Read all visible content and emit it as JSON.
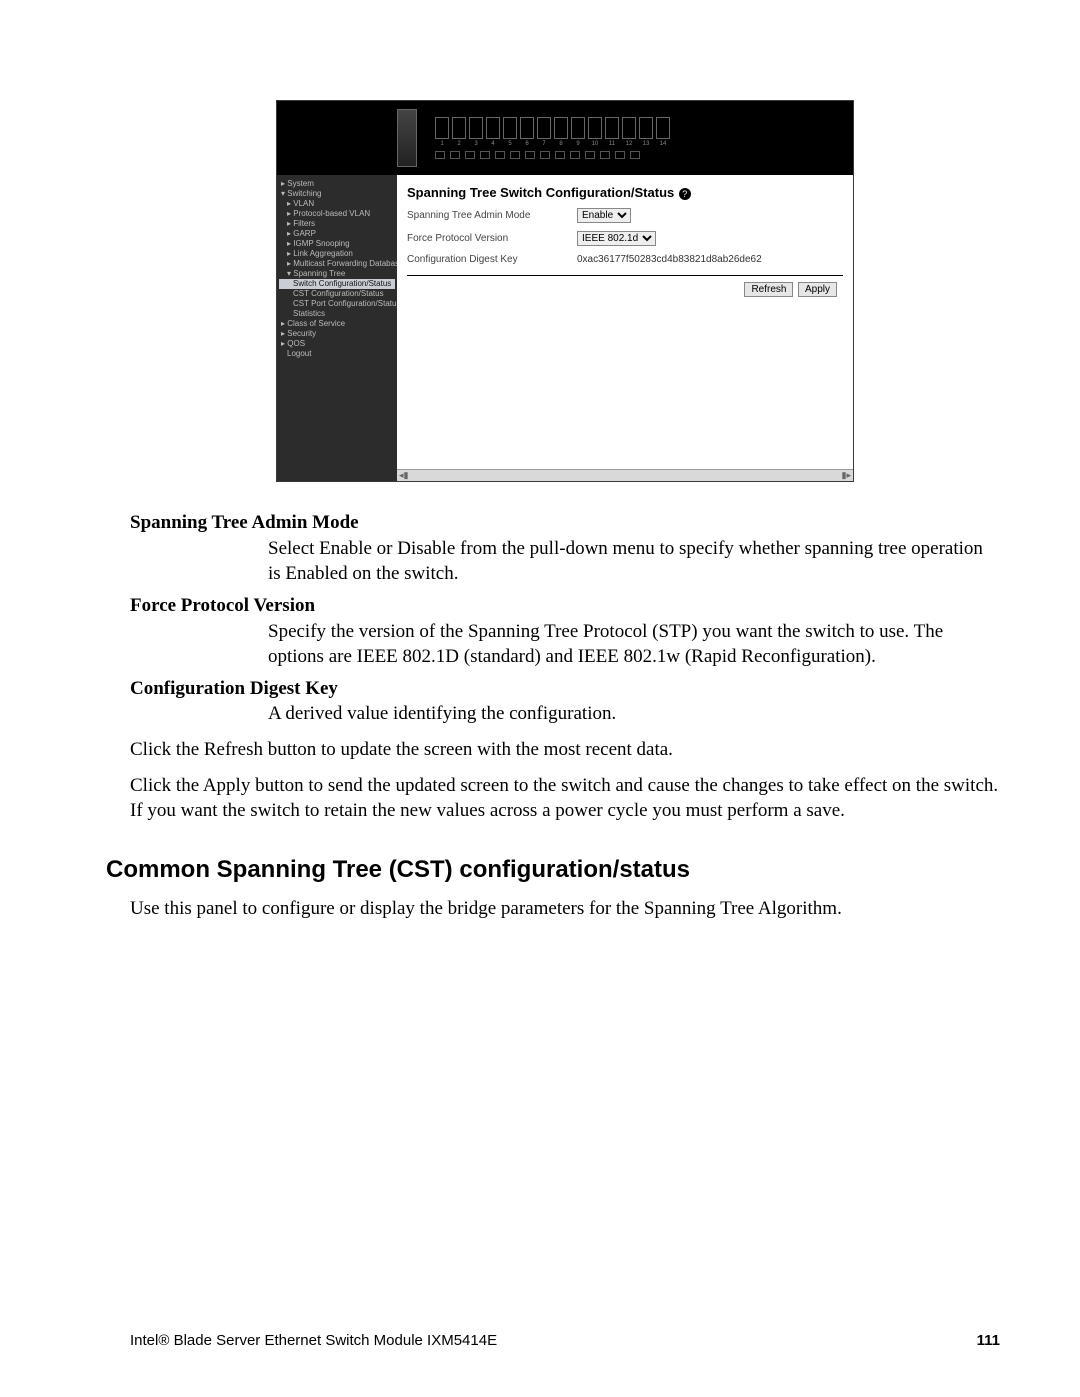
{
  "screenshot": {
    "port_count": 14,
    "panel_title": "Spanning Tree Switch Configuration/Status",
    "help_symbol": "?",
    "fields": {
      "admin_mode": {
        "label": "Spanning Tree Admin Mode",
        "value": "Enable"
      },
      "protocol": {
        "label": "Force Protocol Version",
        "value": "IEEE 802.1d"
      },
      "digest": {
        "label": "Configuration Digest Key",
        "value": "0xac36177f50283cd4b83821d8ab26de62"
      }
    },
    "buttons": {
      "refresh": "Refresh",
      "apply": "Apply"
    },
    "nav": {
      "system": "System",
      "switching": "Switching",
      "vlan": "VLAN",
      "pvlan": "Protocol-based VLAN",
      "filters": "Filters",
      "garp": "GARP",
      "igmp": "IGMP Snooping",
      "linkagg": "Link Aggregation",
      "mcfd": "Multicast Forwarding Database",
      "sptree": "Spanning Tree",
      "swcfg": "Switch Configuration/Status",
      "cstcfg": "CST Configuration/Status",
      "cstport": "CST Port Configuration/Status",
      "stats": "Statistics",
      "cos": "Class of Service",
      "security": "Security",
      "qos": "QOS",
      "logout": "Logout"
    }
  },
  "doc": {
    "t1": "Spanning Tree Admin Mode",
    "d1": "Select Enable or Disable from the pull-down menu to specify whether spanning tree operation is Enabled on the switch.",
    "t2": "Force Protocol Version",
    "d2": "Specify the version of the Spanning Tree Protocol (STP) you want the switch to use. The options are IEEE 802.1D (standard) and IEEE 802.1w (Rapid Reconfiguration).",
    "t3": "Configuration Digest Key",
    "d3": "A derived value identifying the configuration.",
    "p1": "Click the Refresh button to update the screen with the most recent data.",
    "p2": "Click the Apply button to send the updated screen to the switch and cause the changes to take effect on the switch. If you want the switch to retain the new values across a power cycle you must perform a save.",
    "h2": "Common Spanning Tree (CST) configuration/status",
    "p3": "Use this panel to configure or display the bridge parameters for the Spanning Tree Algorithm."
  },
  "footer": {
    "left": "Intel® Blade Server Ethernet Switch Module IXM5414E",
    "page": "111"
  }
}
